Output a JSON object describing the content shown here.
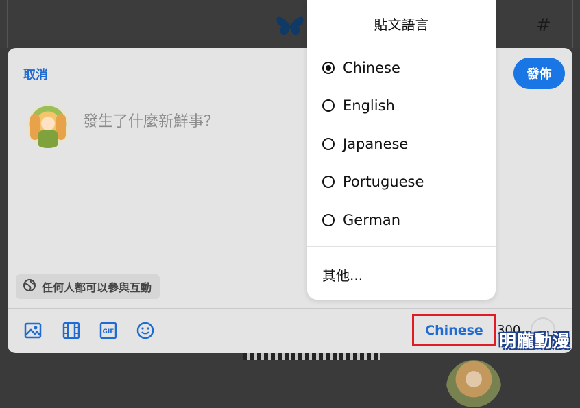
{
  "background": {
    "hash_symbol": "#"
  },
  "composer": {
    "cancel_label": "取消",
    "publish_label": "發佈",
    "placeholder": "發生了什麼新鮮事？",
    "interaction_label": "任何人都可以參與互動",
    "language_button": "Chinese",
    "char_remaining": "300",
    "accent_color": "#1976e4"
  },
  "language_menu": {
    "title": "貼文語言",
    "options": [
      {
        "label": "Chinese",
        "selected": true
      },
      {
        "label": "English",
        "selected": false
      },
      {
        "label": "Japanese",
        "selected": false
      },
      {
        "label": "Portuguese",
        "selected": false
      },
      {
        "label": "German",
        "selected": false
      }
    ],
    "other_label": "其他..."
  },
  "toolbar": {
    "icons": [
      "image-icon",
      "video-icon",
      "gif-icon",
      "emoji-icon"
    ],
    "gif_text": "GIF"
  },
  "watermark": "明朧動漫"
}
